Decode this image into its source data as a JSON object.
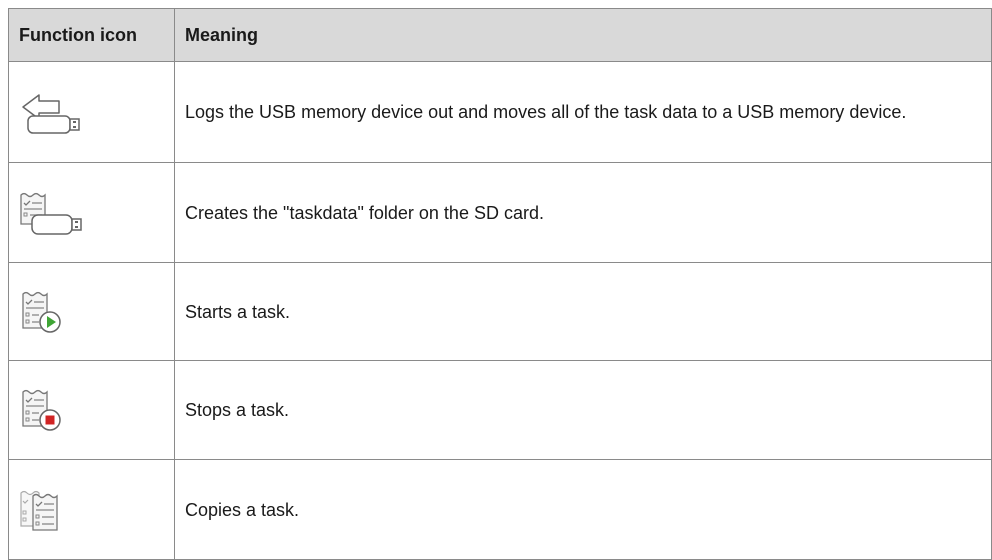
{
  "table": {
    "headers": {
      "icon": "Function icon",
      "meaning": "Meaning"
    },
    "rows": [
      {
        "icon": "usb-logout-icon",
        "meaning": "Logs the USB memory device out and moves all of the task data to a USB memory device."
      },
      {
        "icon": "taskdata-folder-sd-icon",
        "meaning": "Creates the \"taskdata\" folder on the SD card."
      },
      {
        "icon": "start-task-icon",
        "meaning": "Starts a task."
      },
      {
        "icon": "stop-task-icon",
        "meaning": "Stops a task."
      },
      {
        "icon": "copy-task-icon",
        "meaning": "Copies a task."
      }
    ]
  },
  "colors": {
    "header_background": "#d9d9d9",
    "border": "#8a8a8a",
    "play_green": "#3fa535",
    "stop_red": "#d02424"
  }
}
